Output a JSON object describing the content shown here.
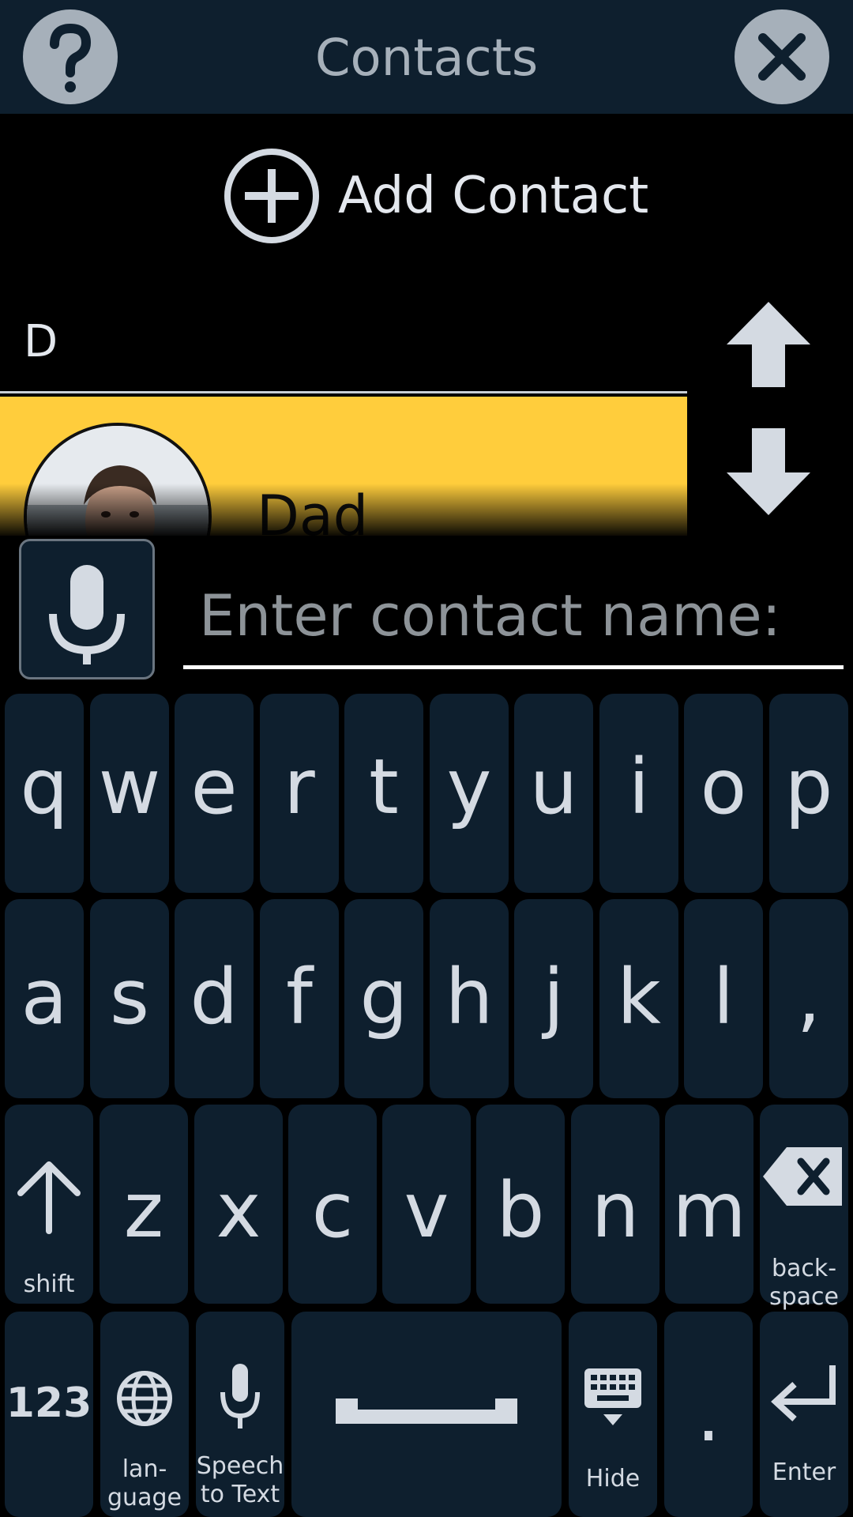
{
  "header": {
    "title": "Contacts",
    "help_icon": "question-mark-icon",
    "close_icon": "close-x-icon"
  },
  "add_contact": {
    "label": "Add Contact",
    "icon": "plus-circle-icon"
  },
  "contacts": {
    "section_letter": "D",
    "items": [
      {
        "name": "Dad",
        "highlight_color": "#ffcd3c"
      }
    ]
  },
  "scroll": {
    "up_icon": "arrow-up-icon",
    "down_icon": "arrow-down-icon"
  },
  "input": {
    "placeholder": "Enter contact name:",
    "value": "",
    "mic_icon": "microphone-icon"
  },
  "keyboard": {
    "row1": [
      "q",
      "w",
      "e",
      "r",
      "t",
      "y",
      "u",
      "i",
      "o",
      "p"
    ],
    "row2": [
      "a",
      "s",
      "d",
      "f",
      "g",
      "h",
      "j",
      "k",
      "l",
      ","
    ],
    "row3": [
      "z",
      "x",
      "c",
      "v",
      "b",
      "n",
      "m"
    ],
    "shift_label": "shift",
    "backspace_label": "back-\nspace",
    "numbers_label": "123",
    "language_label": "lan-\nguage",
    "speech_label": "Speech\nto Text",
    "hide_label": "Hide",
    "period_label": ".",
    "enter_label": "Enter"
  },
  "colors": {
    "background": "#000000",
    "panel": "#0e1f2e",
    "highlight": "#ffcd3c",
    "text": "#d4dae2"
  }
}
